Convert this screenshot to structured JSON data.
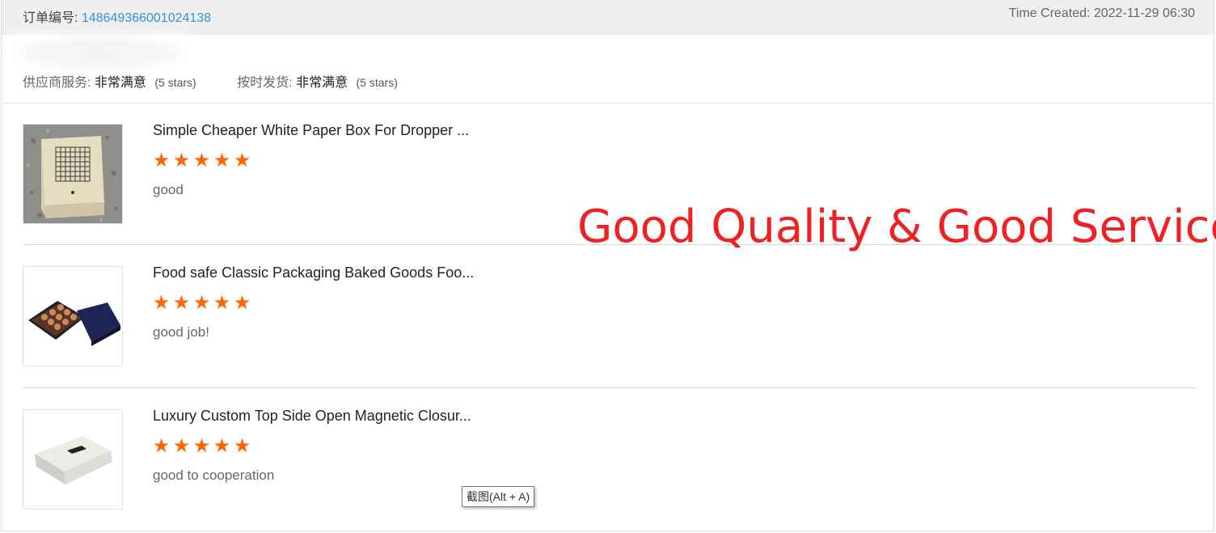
{
  "header": {
    "order_label": "订单编号:",
    "order_number": "148649366001024138",
    "time_created": "Time Created: 2022-11-29 06:30"
  },
  "ratings": [
    {
      "label": "供应商服务:",
      "value": "非常满意",
      "stars_text": "(5 stars)"
    },
    {
      "label": "按时发货:",
      "value": "非常满意",
      "stars_text": "(5 stars)"
    }
  ],
  "items": [
    {
      "title": "Simple Cheaper White Paper Box For Dropper ...",
      "rating": 5,
      "comment": "good"
    },
    {
      "title": "Food safe Classic Packaging Baked Goods Foo...",
      "rating": 5,
      "comment": "good job!"
    },
    {
      "title": "Luxury Custom Top Side Open Magnetic Closur...",
      "rating": 5,
      "comment": "good to cooperation"
    }
  ],
  "overlay": {
    "text": "Good Quality & Good Service!",
    "color": "#ee2222"
  },
  "tooltip": {
    "text": "截图(Alt + A)"
  },
  "colors": {
    "accent_link": "#3b8fd6",
    "star": "#ff6600",
    "header_bg": "#efefef"
  }
}
